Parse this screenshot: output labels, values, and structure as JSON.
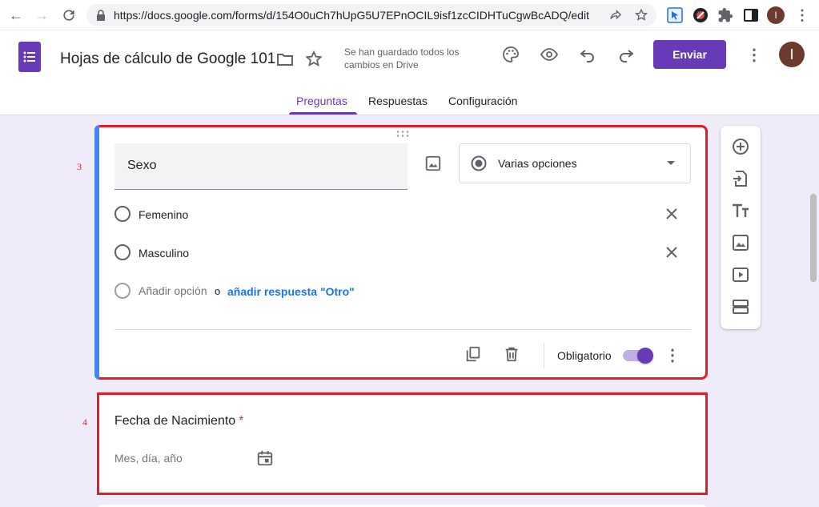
{
  "browser": {
    "url": "https://docs.google.com/forms/d/154O0uCh7hUpG5U7EPnOCIL9isf1zcCIDHTuCgwBcADQ/edit",
    "avatar_initial": "I"
  },
  "header": {
    "title": "Hojas de cálculo de Google 101",
    "save_status": "Se han guardado todos los cambios en Drive",
    "send_label": "Enviar",
    "avatar_initial": "I"
  },
  "tabs": [
    {
      "label": "Preguntas",
      "active": true
    },
    {
      "label": "Respuestas",
      "active": false
    },
    {
      "label": "Configuración",
      "active": false
    }
  ],
  "question1": {
    "number": "3",
    "title": "Sexo",
    "type": "Varias opciones",
    "options": [
      "Femenino",
      "Masculino"
    ],
    "add_option": "Añadir opción",
    "or": "o",
    "add_other": "añadir respuesta \"Otro\"",
    "required_label": "Obligatorio",
    "required": true
  },
  "question2": {
    "number": "4",
    "title": "Fecha de Nacimiento",
    "required_mark": "*",
    "placeholder": "Mes, día, año"
  },
  "colors": {
    "accent": "#673ab7",
    "annotation": "#e51c23",
    "focus": "#4285f4",
    "link": "#1a73e8"
  }
}
